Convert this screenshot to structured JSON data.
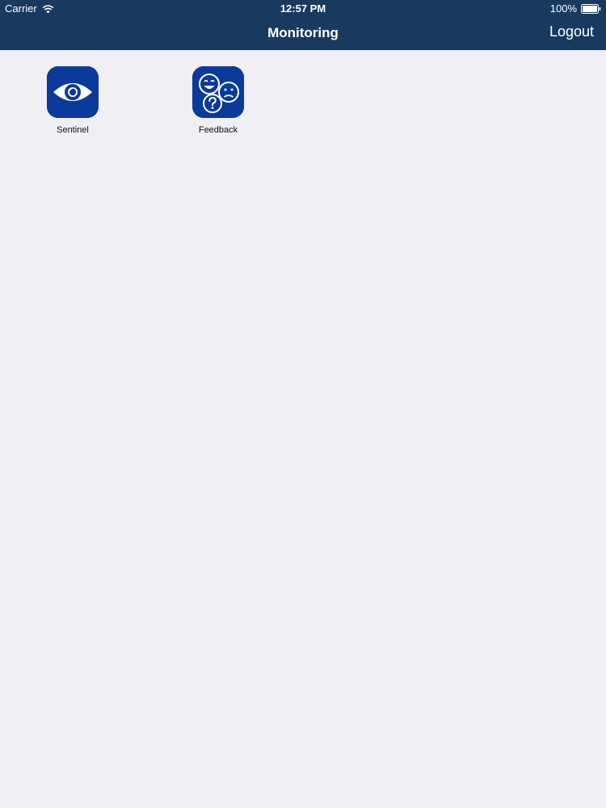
{
  "status_bar": {
    "carrier": "Carrier",
    "time": "12:57 PM",
    "battery": "100%"
  },
  "nav": {
    "title": "Monitoring",
    "logout_label": "Logout"
  },
  "apps": [
    {
      "label": "Sentinel",
      "icon": "eye-icon"
    },
    {
      "label": "Feedback",
      "icon": "faces-feedback-icon"
    }
  ],
  "colors": {
    "header": "#183a5e",
    "app_icon": "#0a3a9a",
    "background": "#efeff4"
  }
}
